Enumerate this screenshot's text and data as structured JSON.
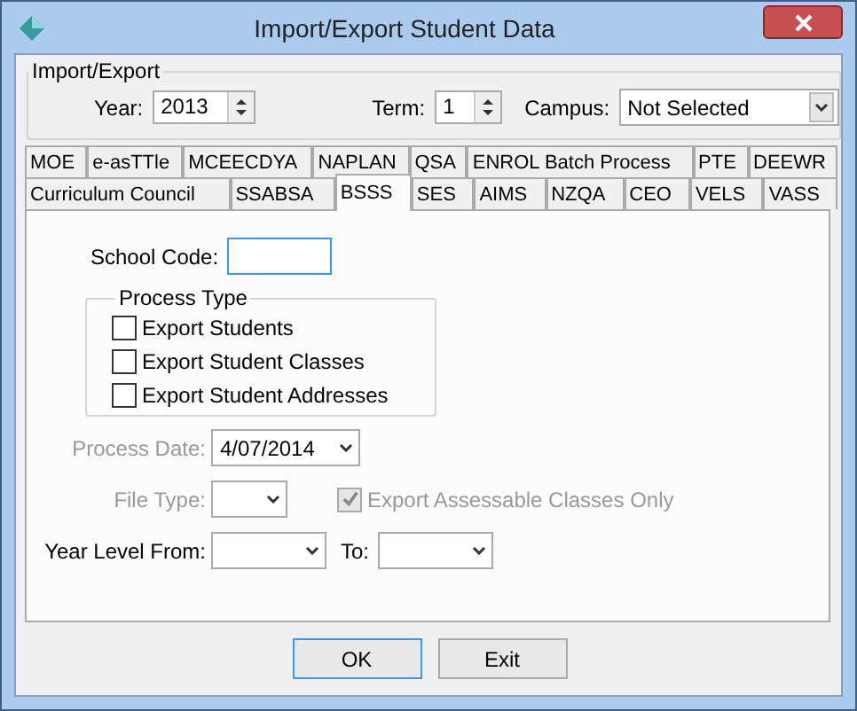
{
  "window": {
    "title": "Import/Export Student Data"
  },
  "import_export": {
    "label": "Import/Export",
    "year": {
      "label": "Year:",
      "value": "2013"
    },
    "term": {
      "label": "Term:",
      "value": "1"
    },
    "campus": {
      "label": "Campus:",
      "value": "Not Selected"
    }
  },
  "tab_rows": [
    [
      {
        "label": "MOE",
        "selected": false
      },
      {
        "label": "e-asTTle",
        "selected": false
      },
      {
        "label": "MCEECDYA",
        "selected": false
      },
      {
        "label": "NAPLAN",
        "selected": false
      },
      {
        "label": "QSA",
        "selected": false
      },
      {
        "label": "ENROL Batch Process",
        "selected": false
      },
      {
        "label": "PTE",
        "selected": false
      },
      {
        "label": "DEEWR",
        "selected": false
      }
    ],
    [
      {
        "label": "Curriculum Council",
        "selected": false
      },
      {
        "label": "SSABSA",
        "selected": false
      },
      {
        "label": "BSSS",
        "selected": true
      },
      {
        "label": "SES",
        "selected": false
      },
      {
        "label": "AIMS",
        "selected": false
      },
      {
        "label": "NZQA",
        "selected": false
      },
      {
        "label": "CEO",
        "selected": false
      },
      {
        "label": "VELS",
        "selected": false
      },
      {
        "label": "VASS",
        "selected": false
      }
    ]
  ],
  "school_code": {
    "label": "School Code:"
  },
  "process_type": {
    "label": "Process Type",
    "options": [
      {
        "label": "Export Students",
        "checked": false
      },
      {
        "label": "Export Student Classes",
        "checked": false
      },
      {
        "label": "Export Student Addresses",
        "checked": false
      }
    ]
  },
  "process_date": {
    "label": "Process Date:",
    "value": "4/07/2014",
    "disabled": true
  },
  "file_type": {
    "label": "File Type:",
    "disabled": true
  },
  "export_assessable": {
    "label": "Export Assessable Classes Only",
    "checked": true,
    "disabled": true
  },
  "year_level_from": {
    "label": "Year Level From:"
  },
  "year_level_to": {
    "label": "To:"
  },
  "buttons": [
    {
      "label": "OK",
      "focused": true
    },
    {
      "label": "Exit",
      "focused": false
    }
  ]
}
